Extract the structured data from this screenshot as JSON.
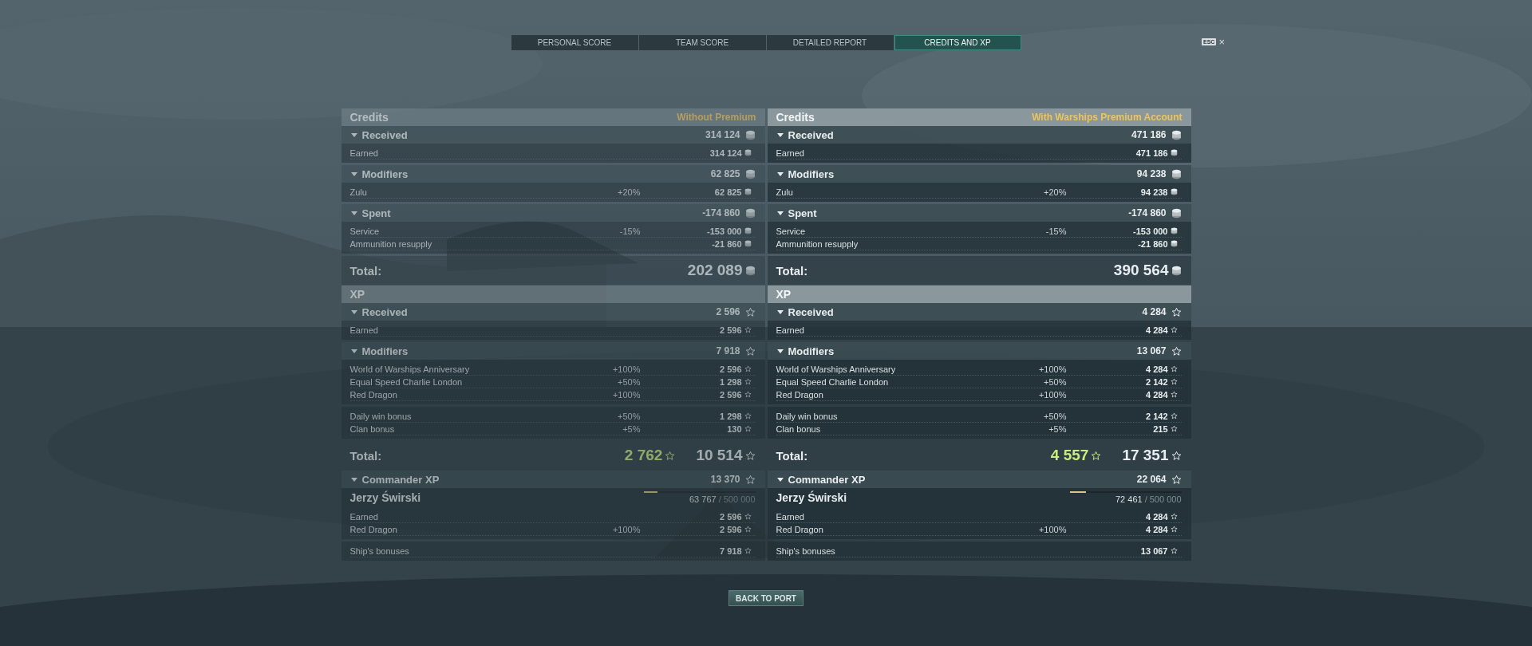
{
  "tabs": [
    {
      "label": "PERSONAL SCORE",
      "selected": false
    },
    {
      "label": "TEAM SCORE",
      "selected": false
    },
    {
      "label": "DETAILED REPORT",
      "selected": false
    },
    {
      "label": "CREDITS AND XP",
      "selected": true
    }
  ],
  "esc": {
    "key": "ESC",
    "close": "×"
  },
  "columns": [
    {
      "premium": false,
      "sections": [
        {
          "kind": "credits",
          "title": "Credits",
          "account": "Without Premium",
          "groups": [
            {
              "title": "Received",
              "total": "314 124",
              "blocks": [
                [
                  {
                    "name": "Earned",
                    "value": "314 124"
                  }
                ]
              ]
            },
            {
              "title": "Modifiers",
              "total": "62 825",
              "blocks": [
                [
                  {
                    "name": "Zulu",
                    "percent": "+20%",
                    "value": "62 825"
                  }
                ]
              ]
            },
            {
              "title": "Spent",
              "total": "-174 860",
              "blocks": [
                [
                  {
                    "name": "Service",
                    "percent": "-15%",
                    "value": "-153 000"
                  },
                  {
                    "name": "Ammunition resupply",
                    "value": "-21 860"
                  }
                ]
              ]
            }
          ],
          "total_label": "Total:",
          "totals": [
            {
              "kind": "main",
              "value": "202 089"
            }
          ]
        },
        {
          "kind": "xp",
          "title": "XP",
          "groups": [
            {
              "title": "Received",
              "total": "2 596",
              "blocks": [
                [
                  {
                    "name": "Earned",
                    "value": "2 596"
                  }
                ]
              ]
            },
            {
              "title": "Modifiers",
              "total": "7 918",
              "blocks": [
                [
                  {
                    "name": "World of Warships Anniversary",
                    "percent": "+100%",
                    "value": "2 596"
                  },
                  {
                    "name": "Equal Speed Charlie London",
                    "percent": "+50%",
                    "value": "1 298"
                  },
                  {
                    "name": "Red Dragon",
                    "percent": "+100%",
                    "value": "2 596"
                  }
                ],
                [
                  {
                    "name": "Daily win bonus",
                    "percent": "+50%",
                    "value": "1 298"
                  },
                  {
                    "name": "Clan bonus",
                    "percent": "+5%",
                    "value": "130"
                  }
                ]
              ]
            }
          ],
          "total_label": "Total:",
          "totals": [
            {
              "kind": "highlight",
              "value": "2 762"
            },
            {
              "kind": "main",
              "value": "10 514"
            }
          ]
        }
      ],
      "commander": {
        "title": "Commander XP",
        "total": "13 370",
        "name": "Jerzy Świrski",
        "level": 0.1275,
        "progress": "63 767",
        "max": "/ 500 000",
        "blocks": [
          [
            {
              "name": "Earned",
              "value": "2 596"
            },
            {
              "name": "Red Dragon",
              "percent": "+100%",
              "value": "2 596"
            }
          ],
          [
            {
              "name": "Ship's bonuses",
              "value": "7 918"
            }
          ]
        ]
      }
    },
    {
      "premium": true,
      "sections": [
        {
          "kind": "credits",
          "title": "Credits",
          "account": "With Warships Premium Account",
          "groups": [
            {
              "title": "Received",
              "total": "471 186",
              "blocks": [
                [
                  {
                    "name": "Earned",
                    "value": "471 186"
                  }
                ]
              ]
            },
            {
              "title": "Modifiers",
              "total": "94 238",
              "blocks": [
                [
                  {
                    "name": "Zulu",
                    "percent": "+20%",
                    "value": "94 238"
                  }
                ]
              ]
            },
            {
              "title": "Spent",
              "total": "-174 860",
              "blocks": [
                [
                  {
                    "name": "Service",
                    "percent": "-15%",
                    "value": "-153 000"
                  },
                  {
                    "name": "Ammunition resupply",
                    "value": "-21 860"
                  }
                ]
              ]
            }
          ],
          "total_label": "Total:",
          "totals": [
            {
              "kind": "main",
              "value": "390 564"
            }
          ]
        },
        {
          "kind": "xp",
          "title": "XP",
          "groups": [
            {
              "title": "Received",
              "total": "4 284",
              "blocks": [
                [
                  {
                    "name": "Earned",
                    "value": "4 284"
                  }
                ]
              ]
            },
            {
              "title": "Modifiers",
              "total": "13 067",
              "blocks": [
                [
                  {
                    "name": "World of Warships Anniversary",
                    "percent": "+100%",
                    "value": "4 284"
                  },
                  {
                    "name": "Equal Speed Charlie London",
                    "percent": "+50%",
                    "value": "2 142"
                  },
                  {
                    "name": "Red Dragon",
                    "percent": "+100%",
                    "value": "4 284"
                  }
                ],
                [
                  {
                    "name": "Daily win bonus",
                    "percent": "+50%",
                    "value": "2 142"
                  },
                  {
                    "name": "Clan bonus",
                    "percent": "+5%",
                    "value": "215"
                  }
                ]
              ]
            }
          ],
          "total_label": "Total:",
          "totals": [
            {
              "kind": "highlight",
              "value": "4 557"
            },
            {
              "kind": "main",
              "value": "17 351"
            }
          ]
        }
      ],
      "commander": {
        "title": "Commander XP",
        "total": "22 064",
        "name": "Jerzy Świrski",
        "level": 0.145,
        "progress": "72 461",
        "max": "/ 500 000",
        "blocks": [
          [
            {
              "name": "Earned",
              "value": "4 284"
            },
            {
              "name": "Red Dragon",
              "percent": "+100%",
              "value": "4 284"
            }
          ],
          [
            {
              "name": "Ship's bonuses",
              "value": "13 067"
            }
          ]
        ]
      }
    }
  ],
  "back_button": "BACK TO PORT"
}
